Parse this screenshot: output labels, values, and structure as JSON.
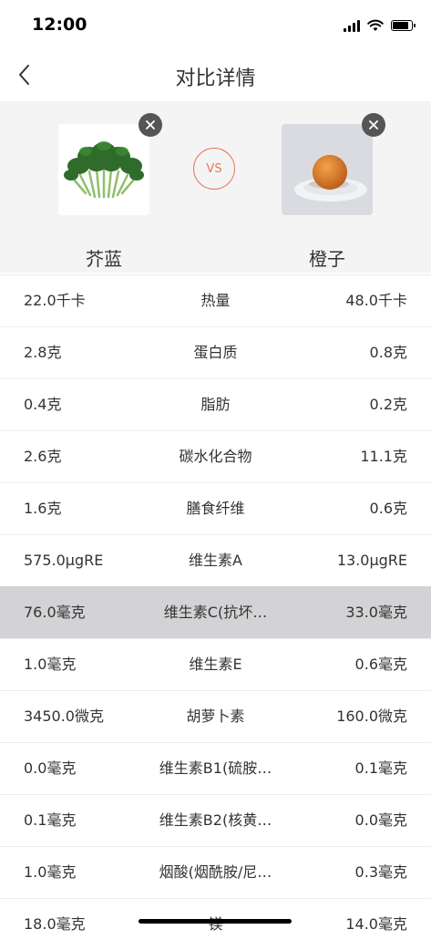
{
  "status_bar": {
    "time": "12:00"
  },
  "nav": {
    "title": "对比详情"
  },
  "compare": {
    "left_food": {
      "name": "芥蓝"
    },
    "right_food": {
      "name": "橙子"
    },
    "vs_label": "VS"
  },
  "nutrients": [
    {
      "left": "22.0千卡",
      "name": "热量",
      "right": "48.0千卡"
    },
    {
      "left": "2.8克",
      "name": "蛋白质",
      "right": "0.8克"
    },
    {
      "left": "0.4克",
      "name": "脂肪",
      "right": "0.2克"
    },
    {
      "left": "2.6克",
      "name": "碳水化合物",
      "right": "11.1克"
    },
    {
      "left": "1.6克",
      "name": "膳食纤维",
      "right": "0.6克"
    },
    {
      "left": "575.0μgRE",
      "name": "维生素A",
      "right": "13.0μgRE"
    },
    {
      "left": "76.0毫克",
      "name": "维生素C(抗坏…",
      "right": "33.0毫克"
    },
    {
      "left": "1.0毫克",
      "name": "维生素E",
      "right": "0.6毫克"
    },
    {
      "left": "3450.0微克",
      "name": "胡萝卜素",
      "right": "160.0微克"
    },
    {
      "left": "0.0毫克",
      "name": "维生素B1(硫胺…",
      "right": "0.1毫克"
    },
    {
      "left": "0.1毫克",
      "name": "维生素B2(核黄…",
      "right": "0.0毫克"
    },
    {
      "left": "1.0毫克",
      "name": "烟酸(烟酰胺/尼…",
      "right": "0.3毫克"
    },
    {
      "left": "18.0毫克",
      "name": "镁",
      "right": "14.0毫克"
    }
  ],
  "colors": {
    "accent": "#e8745f",
    "highlight_row": "#d3d3d6",
    "panel_bg": "#f4f4f4"
  }
}
